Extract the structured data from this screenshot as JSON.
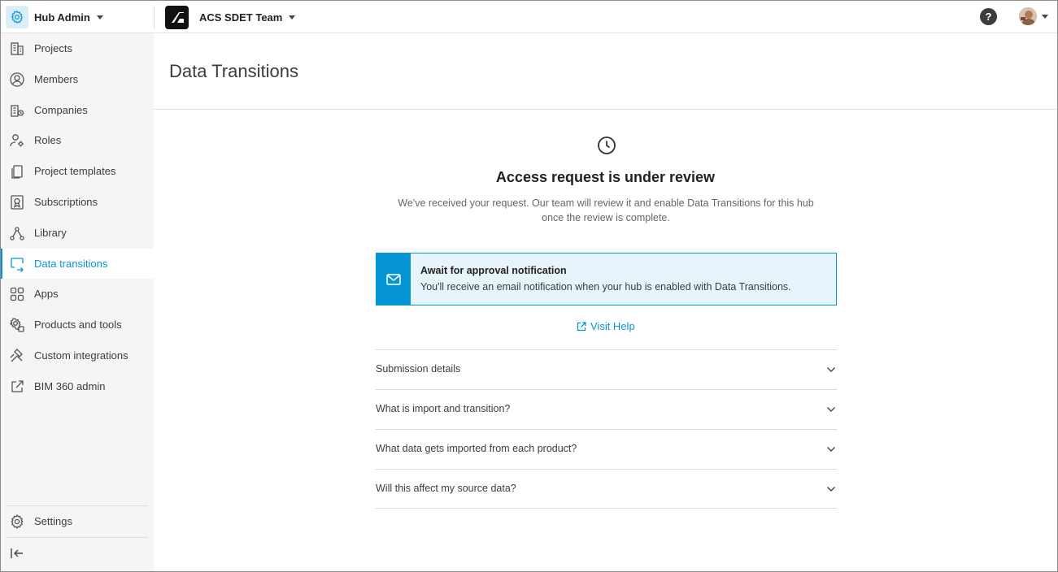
{
  "header": {
    "hub_label": "Hub Admin",
    "team_label": "ACS SDET Team",
    "help_label": "?"
  },
  "sidebar": {
    "items": [
      {
        "label": "Projects",
        "icon": "building-icon"
      },
      {
        "label": "Members",
        "icon": "user-circle-icon"
      },
      {
        "label": "Companies",
        "icon": "company-icon"
      },
      {
        "label": "Roles",
        "icon": "user-gear-icon"
      },
      {
        "label": "Project templates",
        "icon": "template-icon"
      },
      {
        "label": "Subscriptions",
        "icon": "subscription-icon"
      },
      {
        "label": "Library",
        "icon": "library-icon"
      },
      {
        "label": "Data transitions",
        "icon": "data-transition-icon",
        "active": true
      },
      {
        "label": "Apps",
        "icon": "apps-grid-icon"
      },
      {
        "label": "Products and tools",
        "icon": "products-gear-icon"
      },
      {
        "label": "Custom integrations",
        "icon": "integrations-icon"
      },
      {
        "label": "BIM 360 admin",
        "icon": "external-link-icon"
      }
    ],
    "settings_label": "Settings",
    "collapse_icon": "collapse-sidebar-icon"
  },
  "main": {
    "page_title": "Data Transitions",
    "headline": "Access request is under review",
    "description": "We've received your request. Our team will review it and enable Data Transitions for this hub once the review is complete.",
    "notice": {
      "title": "Await for approval notification",
      "text": "You'll receive an email notification when your hub is enabled with Data Transitions."
    },
    "visit_help_label": "Visit Help",
    "accordion": [
      {
        "label": "Submission details"
      },
      {
        "label": "What is import and transition?"
      },
      {
        "label": "What data gets imported from each product?"
      },
      {
        "label": "Will this affect my source data?"
      }
    ]
  },
  "colors": {
    "accent": "#0696d7",
    "notice_bg": "#e8f4fb",
    "sidebar_bg": "#f5f5f5"
  }
}
